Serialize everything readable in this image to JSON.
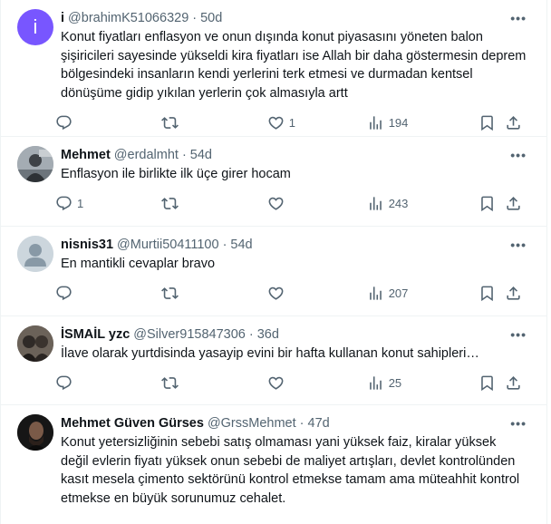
{
  "tweets": [
    {
      "name": "i",
      "handle": "@brahimK51066329",
      "time": "50d",
      "text": "Konut fiyatları enflasyon ve onun dışında konut piyasasını yöneten balon şişiricileri sayesinde yükseldi kira fiyatları ise Allah bir daha göstermesin deprem bölgesindeki insanların kendi yerlerini terk etmesi ve durmadan kentsel dönüşüme gidip yıkılan yerlerin çok almasıyla artt",
      "replies": "",
      "retweets": "",
      "likes": "1",
      "views": "194",
      "avatar_letter": "i",
      "avatar_color": "#7856ff"
    },
    {
      "name": "Mehmet",
      "handle": "@erdalmht",
      "time": "54d",
      "text": "Enflasyon ile birlikte ilk üçe girer hocam",
      "replies": "1",
      "retweets": "",
      "likes": "",
      "views": "243"
    },
    {
      "name": "nisnis31",
      "handle": "@Murtii50411100",
      "time": "54d",
      "text": "En mantikli cevaplar bravo",
      "replies": "",
      "retweets": "",
      "likes": "",
      "views": "207"
    },
    {
      "name": "İSMAİL yzc",
      "handle": "@Silver915847306",
      "time": "36d",
      "text": "İlave olarak yurtdisinda yasayip evini bir hafta kullanan konut sahipleri…",
      "replies": "",
      "retweets": "",
      "likes": "",
      "views": "25"
    },
    {
      "name": "Mehmet Güven Gürses",
      "handle": "@GrssMehmet",
      "time": "47d",
      "text": "Konut yetersizliğinin sebebi satış olmaması yani yüksek faiz, kiralar yüksek değil evlerin fiyatı yüksek onun sebebi de maliyet artışları, devlet kontrolünden kasıt mesela çimento sektörünü kontrol etmekse tamam ama müteahhit kontrol etmekse en büyük sorunumuz cehalet."
    }
  ],
  "separator": "·",
  "more_label": "•••",
  "icons": {
    "reply": "reply-icon",
    "retweet": "retweet-icon",
    "like": "like-icon",
    "views": "views-icon",
    "bookmark": "bookmark-icon",
    "share": "share-icon",
    "more": "more-icon"
  },
  "colors": {
    "text": "#0f1419",
    "secondary": "#536471",
    "border": "#eff3f4"
  }
}
